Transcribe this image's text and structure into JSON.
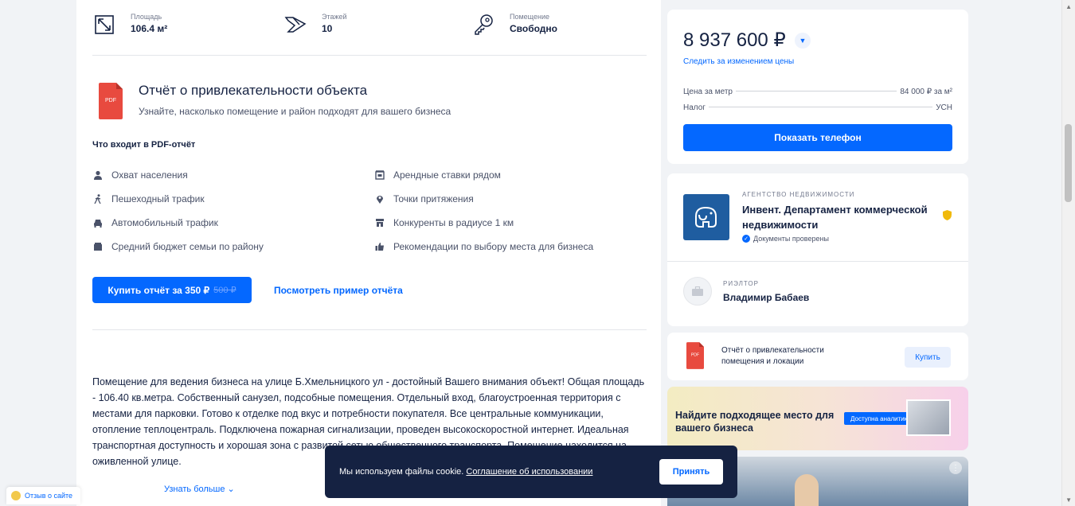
{
  "facts": [
    {
      "label": "Площадь",
      "value": "106.4 м²",
      "icon": "area-icon"
    },
    {
      "label": "Этажей",
      "value": "10",
      "icon": "floors-icon"
    },
    {
      "label": "Помещение",
      "value": "Свободно",
      "icon": "key-icon"
    }
  ],
  "report": {
    "title": "Отчёт о привлекательности объекта",
    "subtitle": "Узнайте, насколько помещение и район подходят для вашего бизнеса",
    "pdf_badge": "PDF",
    "whats_included": "Что входит в PDF-отчёт",
    "features_left": [
      {
        "text": "Охват населения",
        "icon": "person-icon"
      },
      {
        "text": "Пешеходный трафик",
        "icon": "walking-icon"
      },
      {
        "text": "Автомобильный трафик",
        "icon": "car-icon"
      },
      {
        "text": "Средний бюджет семьи по району",
        "icon": "wallet-icon"
      }
    ],
    "features_right": [
      {
        "text": "Арендные ставки рядом",
        "icon": "rent-icon"
      },
      {
        "text": "Точки притяжения",
        "icon": "pin-icon"
      },
      {
        "text": "Конкуренты в радиусе 1 км",
        "icon": "store-icon"
      },
      {
        "text": "Рекомендации по выбору места для бизнеса",
        "icon": "thumbs-up-icon"
      }
    ],
    "buy_label": "Купить отчёт за 350 ₽",
    "buy_old_price": "500 ₽",
    "sample_link": "Посмотреть пример отчёта"
  },
  "description": "Помещение для ведения бизнеса на улице Б.Хмельницкого ул - достойный Вашего внимания объект! Общая площадь - 106.40 кв.метра. Собственный санузел, подсобные помещения. Отдельный вход, благоустроенная территория с местами для парковки. Готово к отделке под вкус и потребности покупателя. Все центральные коммуникации, отопление теплоцентраль. Подключена пожарная сигнализации, проведен высокоскоростной интернет. Идеальная транспортная доступность и хорошая зона с развитой сетью общественного транспорта. Помещение находится на оживленной улице.",
  "show_more": "Узнать больше",
  "price": {
    "amount": "8 937 600 ₽",
    "track_link": "Следить за изменением цены",
    "rows": [
      {
        "label": "Цена за метр",
        "value": "84 000 ₽ за м²"
      },
      {
        "label": "Налог",
        "value": "УСН"
      }
    ],
    "phone_button": "Показать телефон"
  },
  "agency": {
    "type": "АГЕНТСТВО НЕДВИЖИМОСТИ",
    "name": "Инвент. Департамент коммерческой недвижимости",
    "verified": "Документы проверены"
  },
  "realtor": {
    "role": "РИЭЛТОР",
    "name": "Владимир Бабаев"
  },
  "side_report": {
    "title": "Отчёт о привлекательности помещения и локации",
    "button": "Купить"
  },
  "promo": {
    "text": "Найдите подходящее место для вашего бизнеса",
    "badge": "Доступна аналитика"
  },
  "cookie": {
    "text": "Мы используем файлы cookie.",
    "link": "Соглашение об использовании",
    "accept": "Принять"
  },
  "feedback": "Отзыв о сайте",
  "colors": {
    "accent": "#0468ff",
    "dark": "#152242",
    "pdf_red": "#e84a3f"
  }
}
